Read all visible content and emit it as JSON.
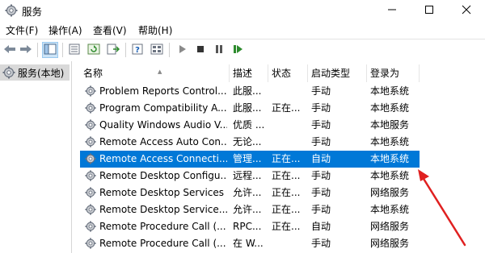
{
  "window": {
    "title": "服务"
  },
  "menu": [
    {
      "label": "文件(F)"
    },
    {
      "label": "操作(A)"
    },
    {
      "label": "查看(V)"
    },
    {
      "label": "帮助(H)"
    }
  ],
  "tree": {
    "selected_label": "服务(本地)"
  },
  "table": {
    "columns": [
      "名称",
      "描述",
      "状态",
      "启动类型",
      "登录为"
    ],
    "rows": [
      {
        "name": "Problem Reports Control...",
        "desc": "此服...",
        "status": "",
        "startup": "手动",
        "logon": "本地系统"
      },
      {
        "name": "Program Compatibility A...",
        "desc": "此服...",
        "status": "正在...",
        "startup": "手动",
        "logon": "本地系统"
      },
      {
        "name": "Quality Windows Audio V...",
        "desc": "优质 ...",
        "status": "",
        "startup": "手动",
        "logon": "本地服务"
      },
      {
        "name": "Remote Access Auto Con...",
        "desc": "无论...",
        "status": "",
        "startup": "手动",
        "logon": "本地系统"
      },
      {
        "name": "Remote Access Connecti...",
        "desc": "管理...",
        "status": "正在...",
        "startup": "自动",
        "logon": "本地系统",
        "selected": true
      },
      {
        "name": "Remote Desktop Configu...",
        "desc": "远程...",
        "status": "正在...",
        "startup": "手动",
        "logon": "本地系统"
      },
      {
        "name": "Remote Desktop Services",
        "desc": "允许...",
        "status": "正在...",
        "startup": "手动",
        "logon": "网络服务"
      },
      {
        "name": "Remote Desktop Service...",
        "desc": "允许...",
        "status": "正在...",
        "startup": "手动",
        "logon": "本地系统"
      },
      {
        "name": "Remote Procedure Call (...",
        "desc": "RPC...",
        "status": "正在...",
        "startup": "自动",
        "logon": "网络服务"
      },
      {
        "name": "Remote Procedure Call (...",
        "desc": "在 W...",
        "status": "",
        "startup": "手动",
        "logon": "网络服务"
      }
    ]
  },
  "colors": {
    "selection": "#0078d7",
    "annotation_arrow": "#e02020"
  }
}
